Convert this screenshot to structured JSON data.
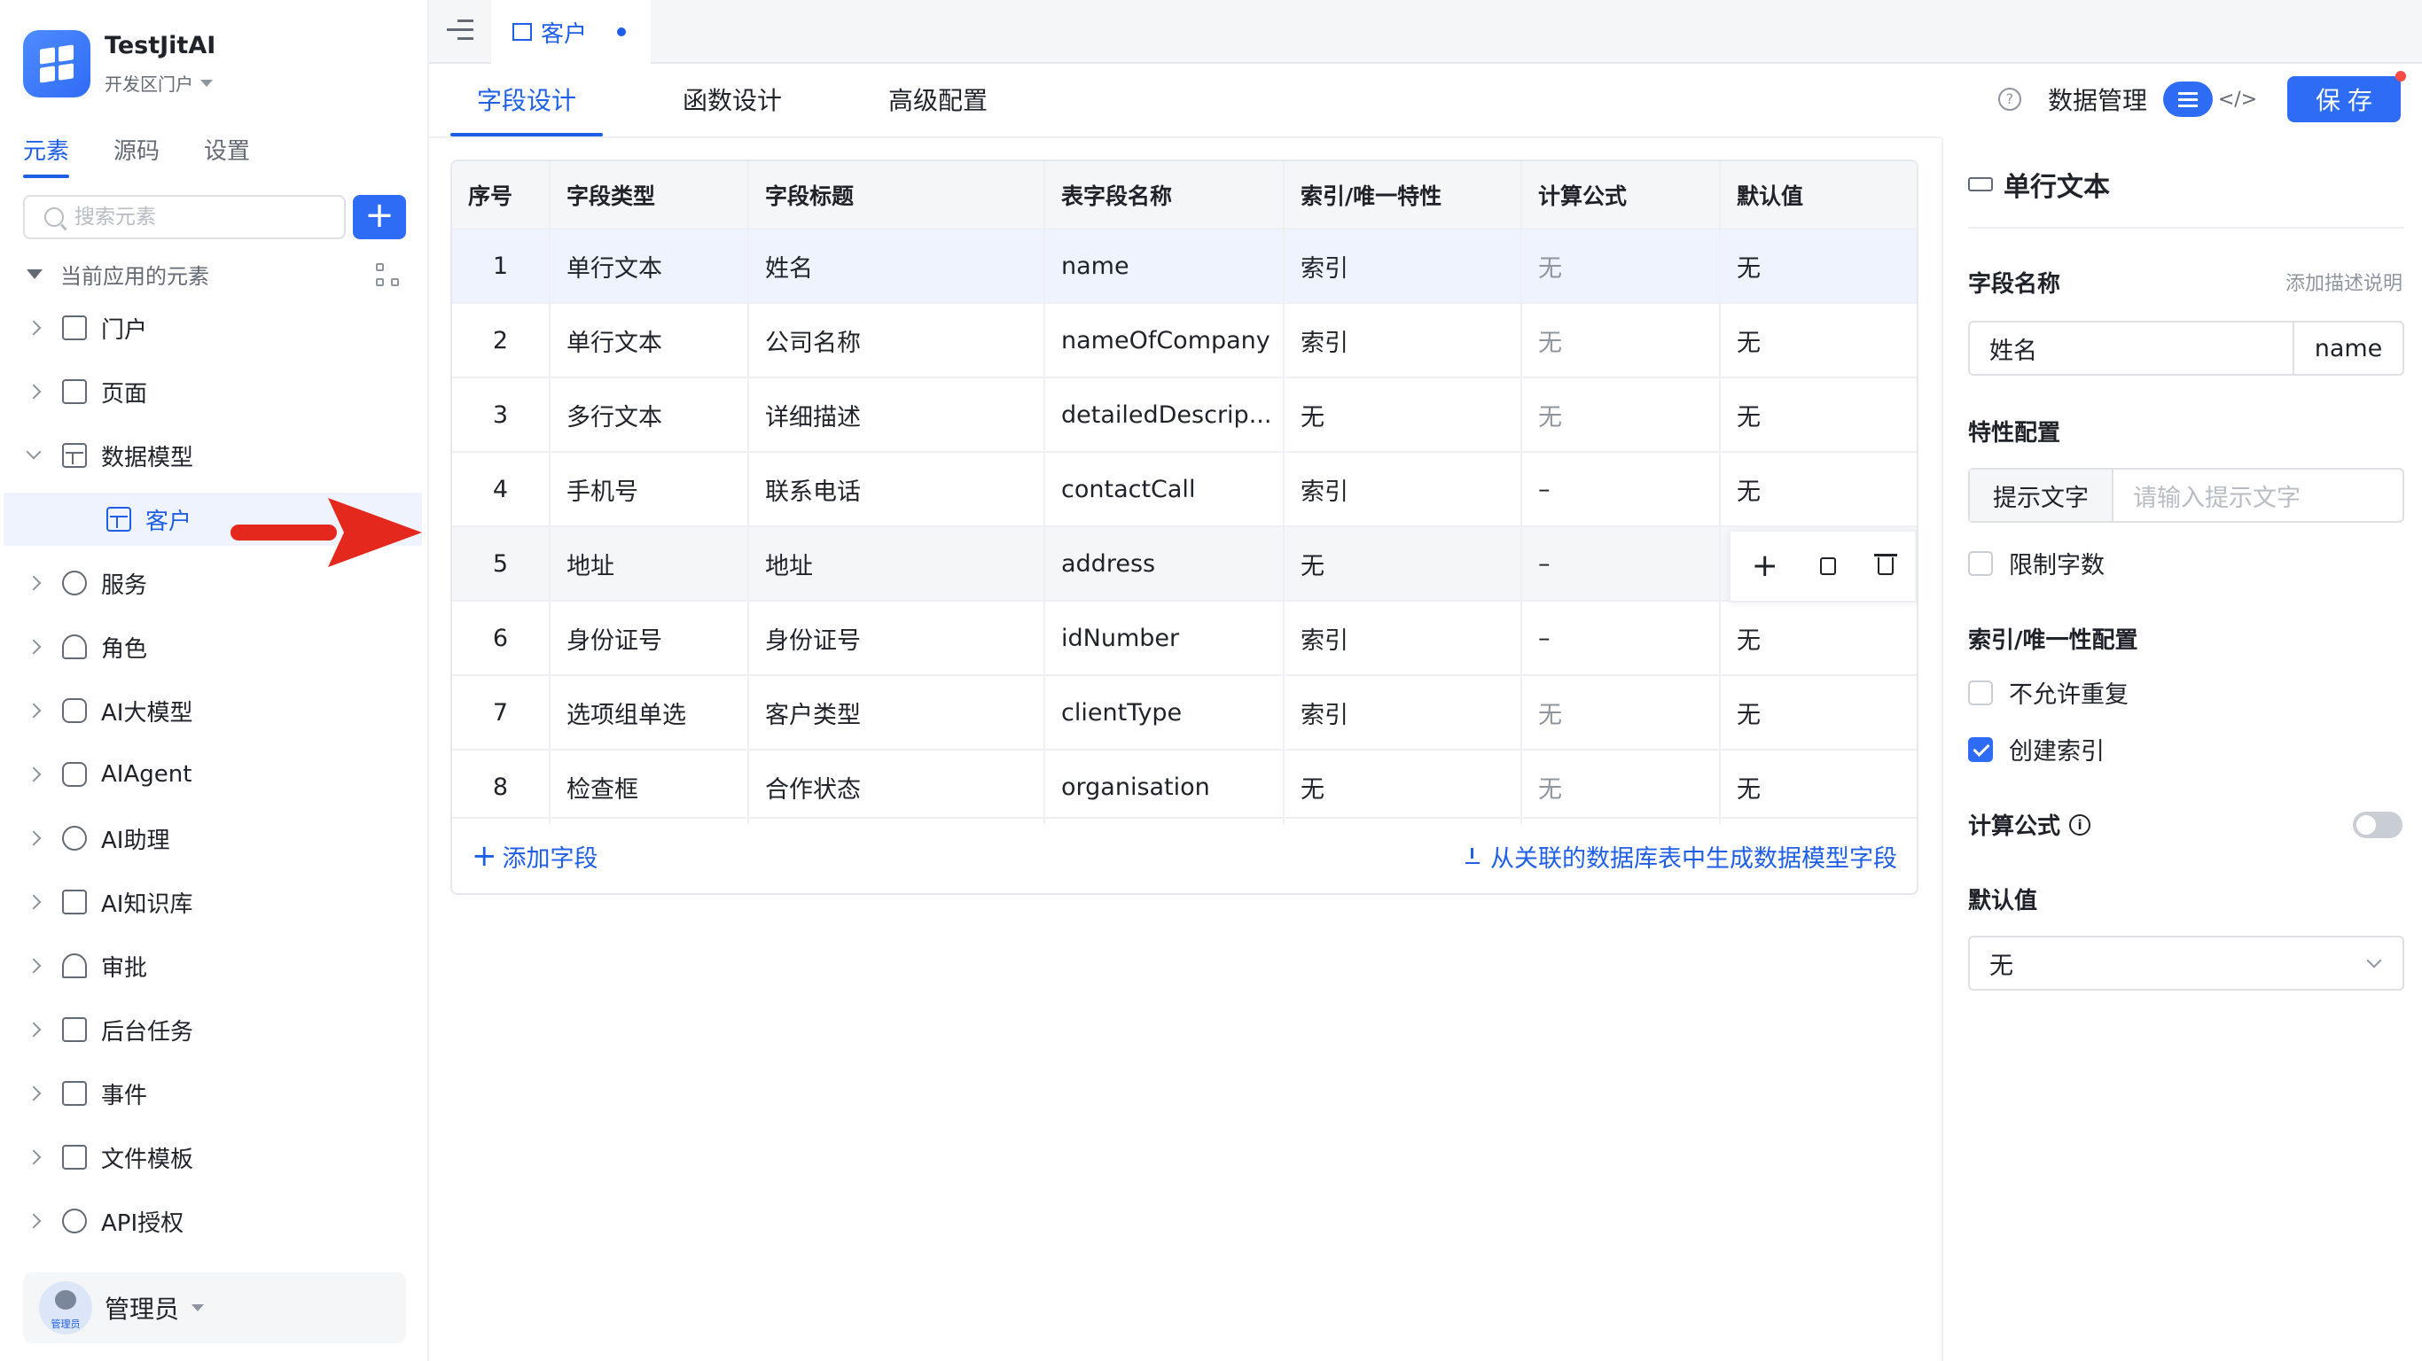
{
  "app": {
    "title": "TestJitAI",
    "portal": "开发区门户"
  },
  "sidebar": {
    "tabs": [
      "元素",
      "源码",
      "设置"
    ],
    "search_placeholder": "搜索元素",
    "tree_header": "当前应用的元素",
    "items": [
      {
        "label": "门户",
        "icon": "portal-icon"
      },
      {
        "label": "页面",
        "icon": "page-icon"
      },
      {
        "label": "数据模型",
        "icon": "table-icon",
        "expanded": true
      },
      {
        "label": "客户",
        "icon": "table-icon",
        "child": true
      },
      {
        "label": "服务",
        "icon": "service-icon"
      },
      {
        "label": "角色",
        "icon": "role-icon"
      },
      {
        "label": "AI大模型",
        "icon": "cube-icon"
      },
      {
        "label": "AIAgent",
        "icon": "robot-icon"
      },
      {
        "label": "AI助理",
        "icon": "ai-icon"
      },
      {
        "label": "AI知识库",
        "icon": "book-icon"
      },
      {
        "label": "审批",
        "icon": "stamp-icon"
      },
      {
        "label": "后台任务",
        "icon": "task-icon"
      },
      {
        "label": "事件",
        "icon": "calendar-icon"
      },
      {
        "label": "文件模板",
        "icon": "file-icon"
      },
      {
        "label": "API授权",
        "icon": "key-icon"
      }
    ],
    "user": {
      "name": "管理员",
      "avatar_label": "管理员"
    }
  },
  "topbar": {
    "tab_label": "客户"
  },
  "main": {
    "tabs": [
      "字段设计",
      "函数设计",
      "高级配置"
    ],
    "toolbar": {
      "data_manage": "数据管理",
      "save": "保存"
    },
    "table": {
      "columns": [
        "序号",
        "字段类型",
        "字段标题",
        "表字段名称",
        "索引/唯一特性",
        "计算公式",
        "默认值"
      ],
      "rows": [
        [
          "1",
          "单行文本",
          "姓名",
          "name",
          "索引",
          "无",
          "无"
        ],
        [
          "2",
          "单行文本",
          "公司名称",
          "nameOfCompany",
          "索引",
          "无",
          "无"
        ],
        [
          "3",
          "多行文本",
          "详细描述",
          "detailedDescrip...",
          "无",
          "无",
          "无"
        ],
        [
          "4",
          "手机号",
          "联系电话",
          "contactCall",
          "索引",
          "–",
          "无"
        ],
        [
          "5",
          "地址",
          "地址",
          "address",
          "无",
          "–",
          ""
        ],
        [
          "6",
          "身份证号",
          "身份证号",
          "idNumber",
          "索引",
          "–",
          "无"
        ],
        [
          "7",
          "选项组单选",
          "客户类型",
          "clientType",
          "索引",
          "无",
          "无"
        ],
        [
          "8",
          "检查框",
          "合作状态",
          "organisation",
          "无",
          "无",
          "无"
        ]
      ],
      "add_field": "添加字段",
      "generate": "从关联的数据库表中生成数据模型字段"
    }
  },
  "panel": {
    "title": "单行文本",
    "field_name_label": "字段名称",
    "add_desc": "添加描述说明",
    "field_name_value": "姓名",
    "field_key_value": "name",
    "feature_label": "特性配置",
    "hint_label": "提示文字",
    "hint_placeholder": "请输入提示文字",
    "limit_label": "限制字数",
    "index_label": "索引/唯一性配置",
    "no_dup_label": "不允许重复",
    "create_index_label": "创建索引",
    "formula_label": "计算公式",
    "default_label": "默认值",
    "default_value": "无"
  },
  "colors": {
    "primary": "#2f6cf6",
    "accent_text": "#1f5fe6",
    "arrow": "#e5281e"
  }
}
